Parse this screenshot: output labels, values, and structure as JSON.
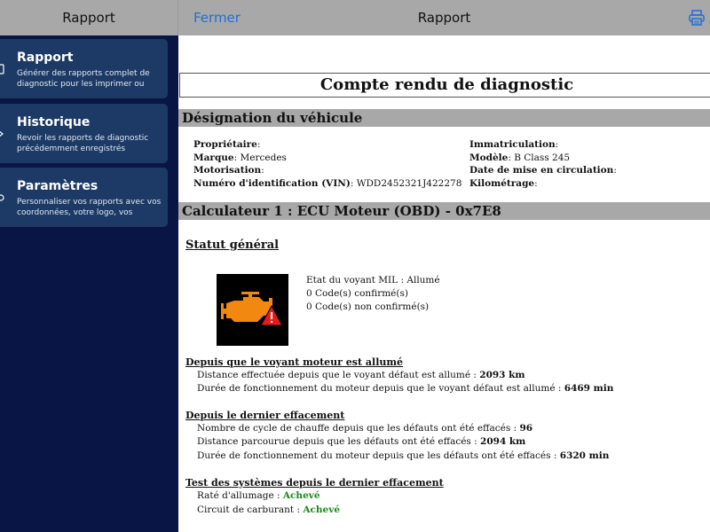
{
  "sidebar": {
    "title": "Rapport",
    "items": [
      {
        "title": "Rapport",
        "desc": "Générer des rapports complet de diagnostic pour les imprimer ou les..."
      },
      {
        "title": "Historique",
        "desc": "Revoir les rapports de diagnostic précédemment enregistrés"
      },
      {
        "title": "Paramètres",
        "desc": "Personnaliser vos rapports avec vos coordonnées, votre logo, vos couleu..."
      }
    ]
  },
  "header": {
    "close_label": "Fermer",
    "title": "Rapport",
    "print_icon": "printer-icon"
  },
  "colors": {
    "accent": "#1f6fd6",
    "sidebar_bg": "#081545",
    "card_bg": "#1d3a66",
    "section_bar": "#a8a8a8",
    "ok": "#1a8a1a",
    "warning": "#f2880f"
  },
  "report": {
    "title": "Compte rendu de diagnostic",
    "vehicle_section": "Désignation du véhicule",
    "vehicle": {
      "left": [
        {
          "label": "Propriétaire",
          "value": ""
        },
        {
          "label": "Marque",
          "value": "Mercedes"
        },
        {
          "label": "Motorisation",
          "value": ""
        },
        {
          "label": "Numéro d'identification (VIN)",
          "value": "WDD2452321J422278"
        }
      ],
      "right": [
        {
          "label": "Immatriculation",
          "value": ""
        },
        {
          "label": "Modèle",
          "value": "B Class 245"
        },
        {
          "label": "Date de mise en circulation",
          "value": ""
        },
        {
          "label": "Kilométrage",
          "value": ""
        }
      ]
    },
    "ecu_section": "Calculateur 1 : ECU Moteur (OBD) - 0x7E8",
    "status_title": "Statut général",
    "mil": {
      "state": "Etat du voyant MIL : Allumé",
      "confirmed": "0 Code(s) confirmé(s)",
      "unconfirmed": "0 Code(s) non confirmé(s)"
    },
    "since_mil": {
      "title": "Depuis que le voyant moteur est allumé",
      "lines": [
        {
          "text": "Distance effectuée depuis que le voyant défaut est allumé : ",
          "value": "2093 km"
        },
        {
          "text": "Durée de fonctionnement du moteur depuis que le voyant défaut est allumé : ",
          "value": "6469 min"
        }
      ]
    },
    "since_clear": {
      "title": "Depuis le dernier effacement",
      "lines": [
        {
          "text": "Nombre de cycle de chauffe depuis que les défauts ont été effacés : ",
          "value": "96"
        },
        {
          "text": "Distance parcourue depuis que les défauts ont été effacés : ",
          "value": "2094 km"
        },
        {
          "text": "Durée de fonctionnement du moteur depuis que les défauts ont été effacés : ",
          "value": "6320 min"
        }
      ]
    },
    "tests": {
      "title": "Test des systèmes depuis le dernier effacement",
      "lines": [
        {
          "text": "Raté d'allumage : ",
          "value": "Achevé"
        },
        {
          "text": "Circuit de carburant : ",
          "value": "Achevé"
        }
      ]
    }
  }
}
